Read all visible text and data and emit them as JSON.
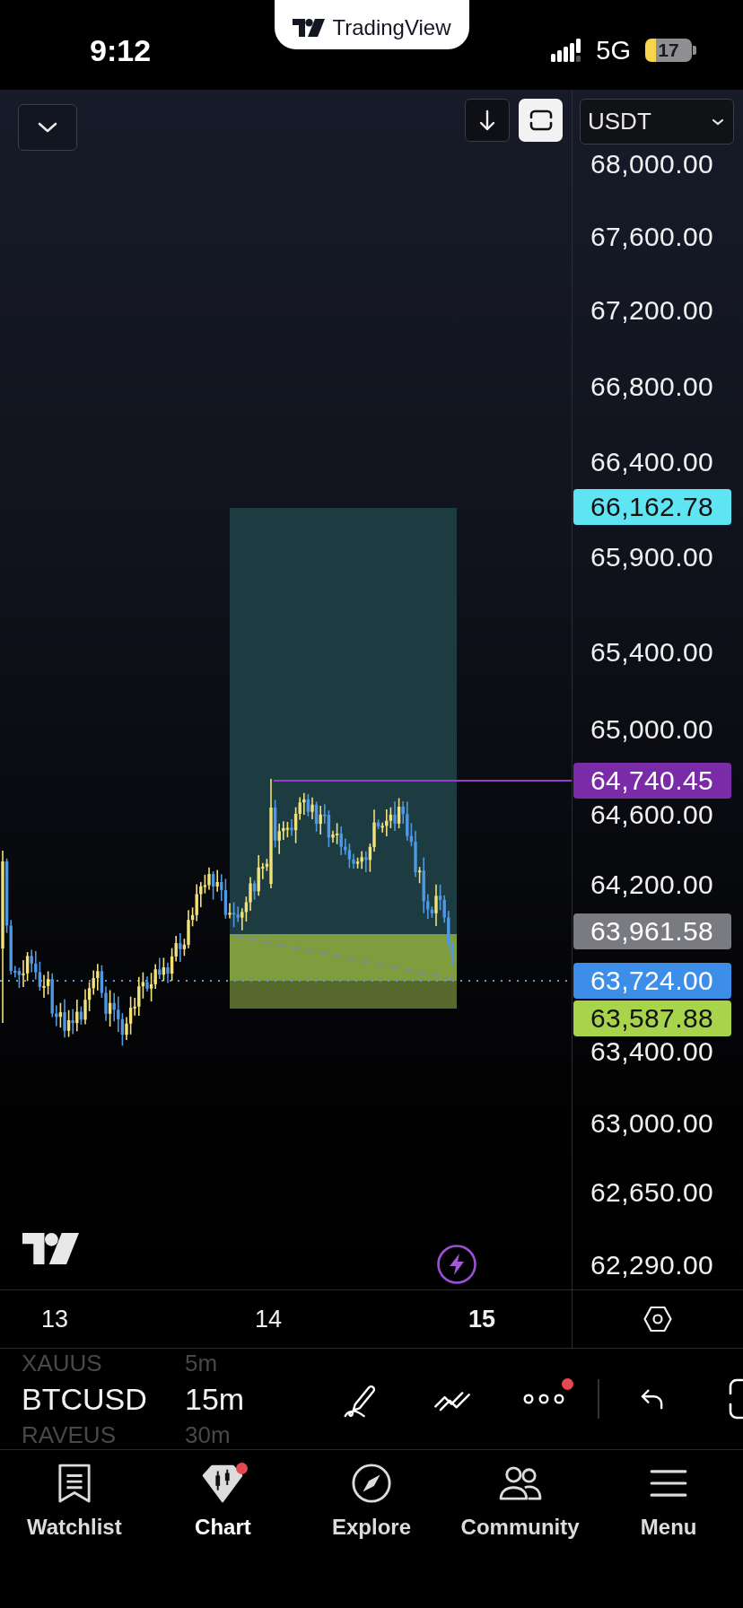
{
  "status_bar": {
    "time": "9:12",
    "network": "5G",
    "battery": "17",
    "low_power_mode": true
  },
  "app_banner": {
    "text": "TradingView"
  },
  "chart_header": {
    "currency": "USDT"
  },
  "price_axis": {
    "labels": [
      "68,000.00",
      "67,600.00",
      "67,200.00",
      "66,800.00",
      "66,400.00",
      "65,900.00",
      "65,400.00",
      "65,000.00",
      "64,600.00",
      "64,200.00",
      "63,400.00",
      "63,000.00",
      "62,650.00",
      "62,290.00"
    ],
    "tags": [
      {
        "text": "66,162.78",
        "color": "#5fe4f4"
      },
      {
        "text": "64,740.45",
        "color": "#7a2ca8"
      },
      {
        "text": "63,961.58",
        "color": "#7a7b80"
      },
      {
        "text": "63,724.00",
        "color": "#3c8ee8"
      },
      {
        "text": "63,587.88",
        "color": "#a8d44c"
      }
    ]
  },
  "time_axis": [
    {
      "text": "13",
      "bold": false
    },
    {
      "text": "14",
      "bold": false
    },
    {
      "text": "15",
      "bold": true
    }
  ],
  "symbol_picker": [
    {
      "text": "XAUUS",
      "selected": false
    },
    {
      "text": "BTCUSD",
      "selected": true
    },
    {
      "text": "RAVEUS",
      "selected": false
    }
  ],
  "interval_picker": [
    {
      "text": "5m",
      "selected": false
    },
    {
      "text": "15m",
      "selected": true
    },
    {
      "text": "30m",
      "selected": false
    }
  ],
  "tools": [
    {
      "kind": "draw",
      "notification": false
    },
    {
      "kind": "multi_line",
      "notification": false
    },
    {
      "kind": "more",
      "notification": true
    },
    {
      "kind": "undo",
      "notification": false
    },
    {
      "kind": "bracket",
      "notification": false
    }
  ],
  "bottom_nav": [
    {
      "kind": "watchlist",
      "label": "Watchlist",
      "selected": false,
      "notification": false
    },
    {
      "kind": "chart",
      "label": "Chart",
      "selected": true,
      "notification": true
    },
    {
      "kind": "explore",
      "label": "Explore",
      "selected": false,
      "notification": false
    },
    {
      "kind": "community",
      "label": "Community",
      "selected": false,
      "notification": false
    },
    {
      "kind": "menu",
      "label": "Menu",
      "selected": false,
      "notification": false
    }
  ]
}
